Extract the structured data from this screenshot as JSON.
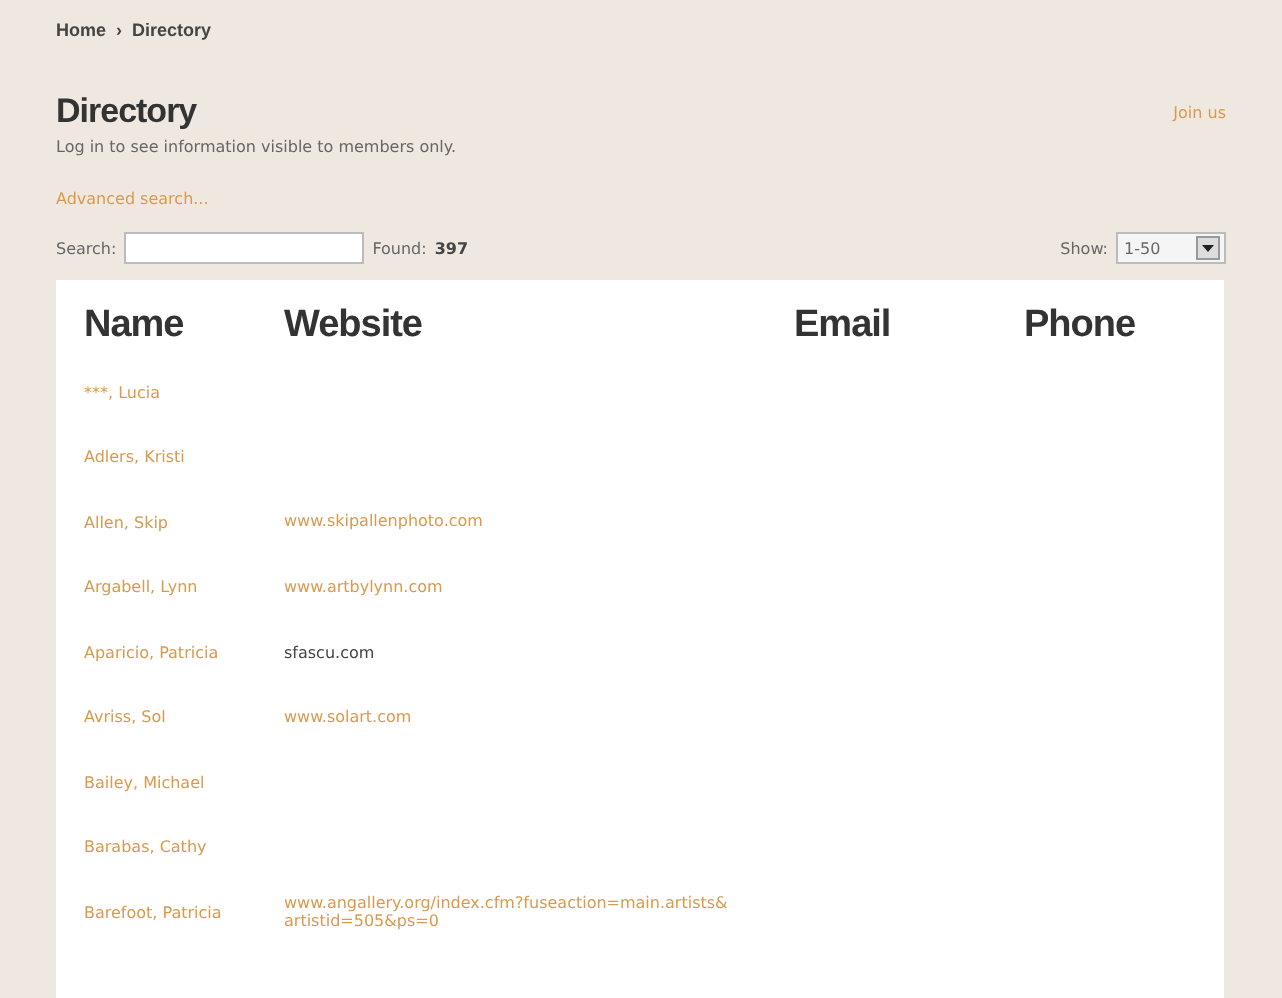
{
  "breadcrumb": [
    "Home",
    "›",
    "Directory"
  ],
  "title": "Directory",
  "join_link": "Join us",
  "notice": "Log in to see information visible to members only.",
  "advanced_search": "Advanced search...",
  "search": {
    "label": "Search:",
    "found_label": "Found:",
    "found_count": "397"
  },
  "show": {
    "label": "Show:",
    "value": "1-50"
  },
  "table": {
    "columns": [
      "Name",
      "Website",
      "Email",
      "Phone"
    ],
    "rows": [
      {
        "name": "***, Lucia"
      },
      {
        "name": "Adlers, Kristi"
      },
      {
        "name": "Allen, Skip",
        "website": {
          "text": "www.skipallenphoto.com",
          "kind": "link"
        }
      },
      {
        "name": "Argabell, Lynn",
        "website": {
          "text": "www.artbylynn.com",
          "kind": "link"
        }
      },
      {
        "name": "Aparicio, Patricia",
        "website": {
          "text": "sfascu.com",
          "kind": "plain"
        }
      },
      {
        "name": "Avriss, Sol",
        "website": {
          "text": "www.solart.com",
          "kind": "link"
        }
      },
      {
        "name": "Bailey, Michael"
      },
      {
        "name": "Barabas, Cathy"
      },
      {
        "name": "Barefoot, Patricia",
        "website": {
          "text": "www.angallery.org/index.cfm?fuseaction=main.artists&artistid=505&ps=0",
          "kind": "link"
        }
      }
    ]
  }
}
